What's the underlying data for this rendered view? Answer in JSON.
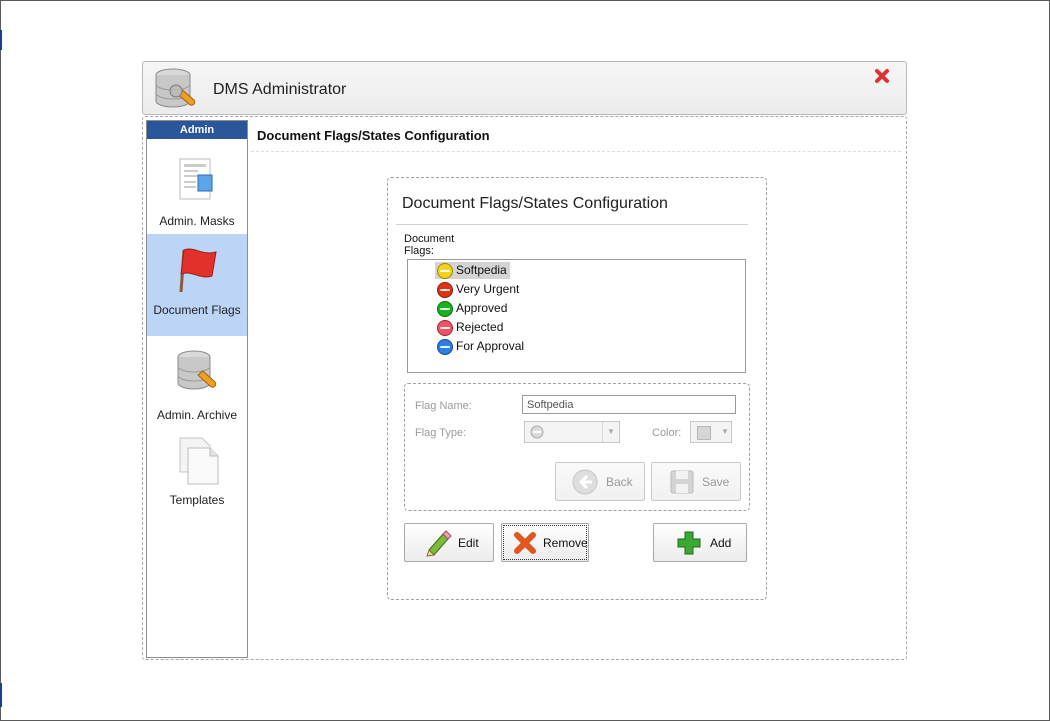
{
  "window": {
    "title": "DMS Administrator"
  },
  "sidebar": {
    "header": "Admin",
    "items": [
      {
        "label": "Admin. Masks",
        "icon": "masks-document-icon"
      },
      {
        "label": "Document Flags",
        "icon": "red-flag-icon",
        "active": true
      },
      {
        "label": "Admin. Archive",
        "icon": "database-archive-icon"
      },
      {
        "label": "Templates",
        "icon": "template-pages-icon"
      }
    ]
  },
  "section": {
    "title": "Document Flags/States Configuration"
  },
  "panel": {
    "title": "Document Flags/States Configuration",
    "flags_label": "Document Flags:",
    "flags": [
      {
        "name": "Softpedia",
        "color": "#f3d21b",
        "selected": true
      },
      {
        "name": "Very Urgent",
        "color": "#e23214"
      },
      {
        "name": "Approved",
        "color": "#19b31f"
      },
      {
        "name": "Rejected",
        "color": "#ef5566"
      },
      {
        "name": "For Approval",
        "color": "#2a7fe0"
      }
    ],
    "form": {
      "flag_name_label": "Flag Name:",
      "flag_name_value": "Softpedia",
      "flag_type_label": "Flag Type:",
      "color_label": "Color:",
      "back_label": "Back",
      "save_label": "Save"
    },
    "actions": {
      "edit_label": "Edit",
      "remove_label": "Remove",
      "add_label": "Add"
    }
  },
  "colors": {
    "sidebar_header": "#2b579a",
    "active_item": "#bcd4f5"
  }
}
